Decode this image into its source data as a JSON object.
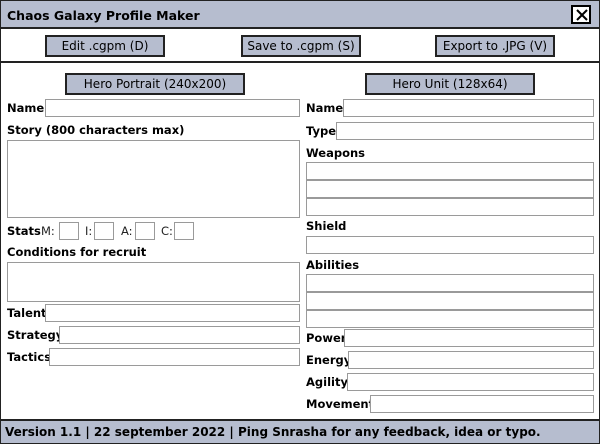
{
  "window": {
    "title": "Chaos Galaxy Profile Maker",
    "close_label": ""
  },
  "toolbar": {
    "edit_label": "Edit .cgpm (D)",
    "save_label": "Save to .cgpm (S)",
    "export_label": "Export to .JPG (V)"
  },
  "hero": {
    "portrait_button": "Hero Portrait (240x200)",
    "name_label": "Name",
    "story_label": "Story (800 characters max)",
    "stats_label": "Stats",
    "stat_m": "M:",
    "stat_i": "I:",
    "stat_a": "A:",
    "stat_c": "C:",
    "conditions_label": "Conditions for recruit",
    "talent_label": "Talent",
    "strategy_label": "Strategy",
    "tactics_label": "Tactics"
  },
  "unit": {
    "unit_button": "Hero Unit (128x64)",
    "name_label": "Name",
    "type_label": "Type",
    "weapons_label": "Weapons",
    "shield_label": "Shield",
    "abilities_label": "Abilities",
    "power_label": "Power",
    "energy_label": "Energy",
    "agility_label": "Agility",
    "movement_label": "Movement"
  },
  "footer": {
    "text": "Version 1.1 | 22 september 2022 | Ping Snrasha for any feedback, idea or typo."
  }
}
